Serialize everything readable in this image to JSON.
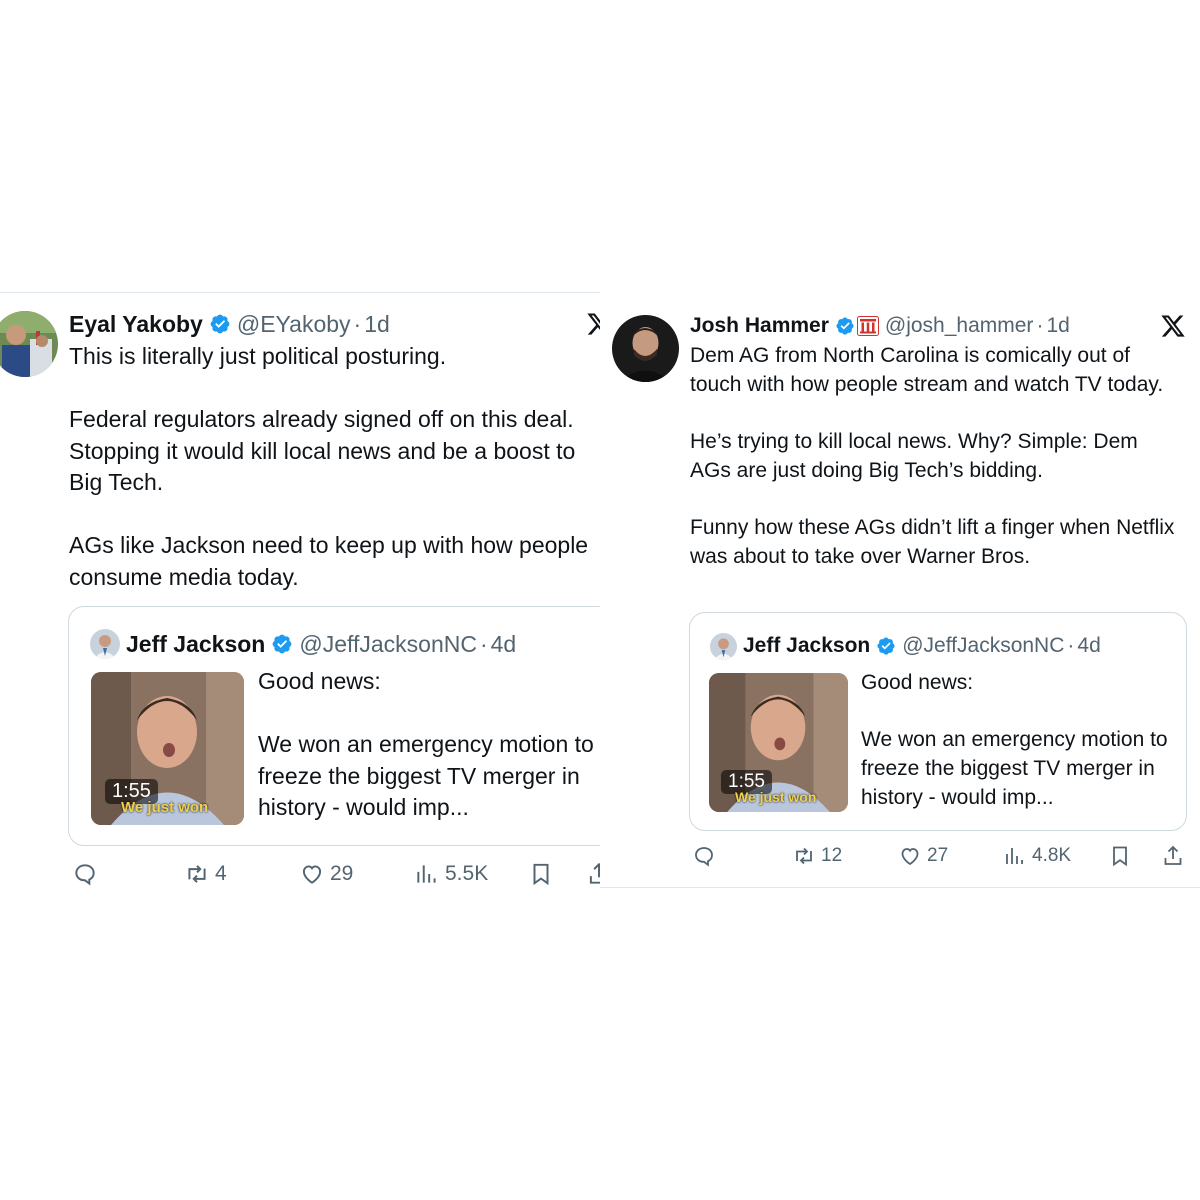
{
  "left_tweet": {
    "author": {
      "name": "Eyal Yakoby",
      "handle": "@EYakoby",
      "time": "1d",
      "separator": "·"
    },
    "text": "This is literally just political posturing.\n\nFederal regulators already signed off on this deal. Stopping it would kill local news and be a boost to Big Tech.\n\nAGs like Jackson need to keep up with how people consume media today.",
    "quoted": {
      "name": "Jeff Jackson",
      "handle": "@JeffJacksonNC",
      "time": "4d",
      "separator": "·",
      "text": "Good news:\n\nWe won an emergency motion to freeze the biggest TV merger in history - would imp...",
      "video_duration": "1:55",
      "video_caption": "We just won"
    },
    "actions": {
      "reply_icon": "reply-icon",
      "retweets": "4",
      "likes": "29",
      "views": "5.5K",
      "bookmark_icon": "bookmark-icon",
      "share_icon": "share-icon"
    }
  },
  "right_tweet": {
    "author": {
      "name": "Josh Hammer",
      "handle": "@josh_hammer",
      "time": "1d",
      "separator": "·"
    },
    "text": "Dem AG from North Carolina is comically out of touch with how people stream and watch TV today.\n\nHe’s trying to kill local news. Why? Simple: Dem AGs are just doing Big Tech’s bidding.\n\nFunny how these AGs didn’t lift a finger when Netflix was about to take over Warner Bros.",
    "quoted": {
      "name": "Jeff Jackson",
      "handle": "@JeffJacksonNC",
      "time": "4d",
      "separator": "·",
      "text": "Good news:\n\nWe won an emergency motion to freeze the biggest TV merger in history - would imp...",
      "video_duration": "1:55",
      "video_caption": "We just won"
    },
    "actions": {
      "reply_icon": "reply-icon",
      "retweets": "12",
      "likes": "27",
      "views": "4.8K",
      "bookmark_icon": "bookmark-icon",
      "share_icon": "share-icon"
    }
  },
  "colors": {
    "verified_blue": "#1d9bf0",
    "text_primary": "#0f1419",
    "text_secondary": "#536471",
    "border": "#cfd9de",
    "affiliate_red": "#d0342c"
  },
  "icons": [
    "verified-badge-icon",
    "affiliate-badge-icon",
    "x-logo-icon",
    "reply-icon",
    "retweet-icon",
    "like-icon",
    "views-icon",
    "bookmark-icon",
    "share-icon"
  ]
}
